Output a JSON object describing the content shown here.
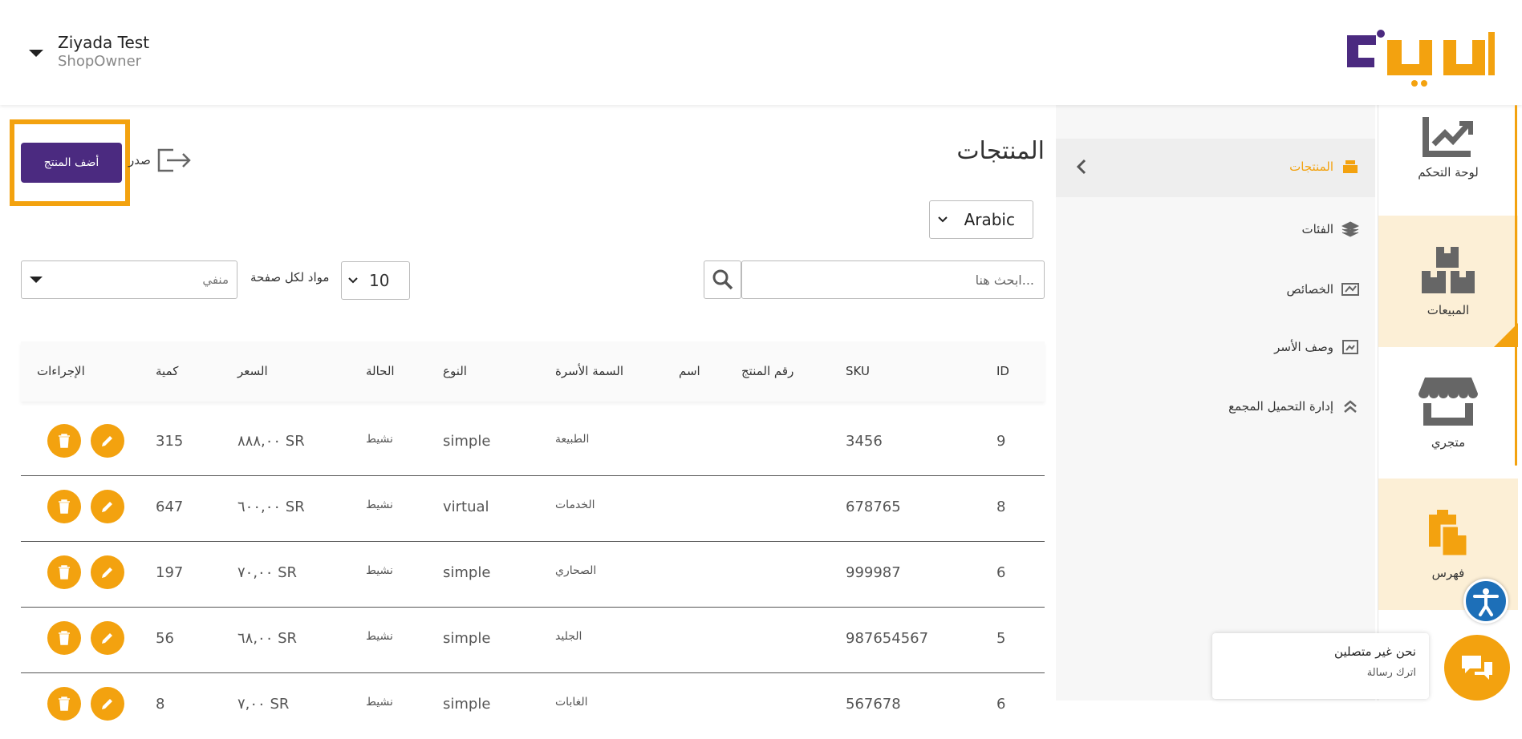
{
  "header": {
    "user_name": "Ziyada Test",
    "user_role": "ShopOwner",
    "logo_text": "كليفا"
  },
  "rail": {
    "items": [
      {
        "label": "لوحة التحكم",
        "icon": "chart-icon"
      },
      {
        "label": "المبيعات",
        "icon": "boxes-icon"
      },
      {
        "label": "متجري",
        "icon": "store-icon"
      },
      {
        "label": "فهرس",
        "icon": "clipboard-icon"
      }
    ]
  },
  "subnav": {
    "items": [
      {
        "label": "المنتجات",
        "icon": "products-icon",
        "active": true
      },
      {
        "label": "الفئات",
        "icon": "layers-icon"
      },
      {
        "label": "الخصائص",
        "icon": "attributes-icon"
      },
      {
        "label": "وصف الأسر",
        "icon": "family-icon"
      },
      {
        "label": "إدارة التحميل المجمع",
        "icon": "double-chevron-up-icon"
      }
    ]
  },
  "main": {
    "title": "المنتجات",
    "add_button": "أضف المنتج",
    "export_label": "صدر",
    "language": "Arabic",
    "search_placeholder": "...ابحث هنا",
    "per_page_value": "10",
    "per_page_label": "مواد لكل صفحة",
    "status_filter": "منفي"
  },
  "table": {
    "headers": {
      "id": "ID",
      "sku": "SKU",
      "product_number": "رقم المنتج",
      "name": "اسم",
      "family": "السمة الأسرة",
      "type": "النوع",
      "status": "الحالة",
      "price": "السعر",
      "qty": "كمية",
      "actions": "الإجراءات"
    },
    "rows": [
      {
        "id": "9",
        "sku": "3456",
        "family": "الطبيعة",
        "type": "simple",
        "status": "نشيط",
        "price": "٨٨٨,٠٠ SR",
        "qty": "315"
      },
      {
        "id": "8",
        "sku": "678765",
        "family": "الخدمات",
        "type": "virtual",
        "status": "نشيط",
        "price": "٦٠٠,٠٠ SR",
        "qty": "647"
      },
      {
        "id": "6",
        "sku": "999987",
        "family": "الصحاري",
        "type": "simple",
        "status": "نشيط",
        "price": "٧٠,٠٠ SR",
        "qty": "197"
      },
      {
        "id": "5",
        "sku": "987654567",
        "family": "الجليد",
        "type": "simple",
        "status": "نشيط",
        "price": "٦٨,٠٠ SR",
        "qty": "56"
      },
      {
        "id": "6",
        "sku": "567678",
        "family": "الغابات",
        "type": "simple",
        "status": "نشيط",
        "price": "٧,٠٠ SR",
        "qty": "8"
      }
    ]
  },
  "chat": {
    "title": "نحن غير متصلين",
    "subtitle": "اترك رسالة"
  },
  "colors": {
    "accent": "#f3a20f",
    "brand_purple": "#4b2a80",
    "rail_alt": "#fcefd6"
  }
}
